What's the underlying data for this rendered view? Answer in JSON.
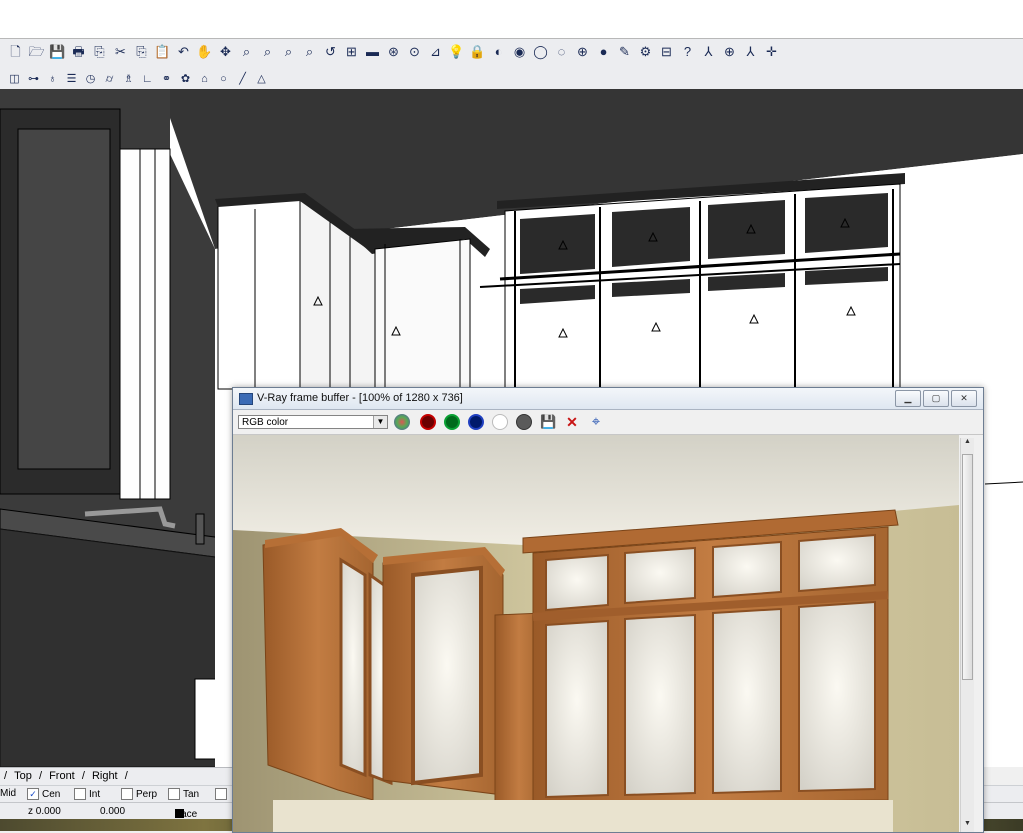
{
  "toolbar_main": {
    "icons": [
      "new-file-icon",
      "open-folder-icon",
      "save-icon",
      "print-icon",
      "import-icon",
      "cut-icon",
      "copy-icon",
      "paste-icon",
      "undo-icon",
      "pan-hand-icon",
      "rotate-view-icon",
      "zoom-icon",
      "zoom-window-icon",
      "zoom-extents-icon",
      "zoom-selected-icon",
      "undo-view-icon",
      "four-views-icon",
      "car-icon",
      "layer-icon",
      "select-icon",
      "properties-icon",
      "light-icon",
      "lock-icon",
      "shaded-icon",
      "rendered-icon",
      "ghosted-icon",
      "xray-icon",
      "render-icon",
      "material-sphere-icon",
      "paint-icon",
      "vray-gear-icon",
      "vray-options-icon",
      "help-icon",
      "axes-icon",
      "cplane-icon",
      "gumball-icon",
      "osnap-icon"
    ],
    "glyphs": [
      "🗋",
      "🗁",
      "💾",
      "🖶",
      "⎘",
      "✂",
      "⎘",
      "📋",
      "↶",
      "✋",
      "✥",
      "⌕",
      "⌕",
      "⌕",
      "⌕",
      "↺",
      "⊞",
      "▬",
      "⊛",
      "⊙",
      "⊿",
      "💡",
      "🔒",
      "◐",
      "◉",
      "◯",
      "◌",
      "⊕",
      "●",
      "✎",
      "⚙",
      "⊟",
      "?",
      "⅄",
      "⊕",
      "⅄",
      "✛"
    ]
  },
  "toolbar_secondary": {
    "icons": [
      "box-edit-icon",
      "join-icon",
      "lamp-icon",
      "list-icon",
      "clock-icon",
      "cylinder-icon",
      "person-icon",
      "angle-icon",
      "group-icon",
      "explode-icon",
      "home-icon",
      "circle-icon",
      "line-icon",
      "polygon-icon"
    ],
    "glyphs": [
      "◫",
      "⊶",
      "♁",
      "☰",
      "◷",
      "⌭",
      "♗",
      "∟",
      "⚭",
      "✿",
      "⌂",
      "○",
      "╱",
      "△"
    ]
  },
  "viewport_tabs": [
    "Top",
    "Front",
    "Right"
  ],
  "osnap": [
    {
      "label": "Mid",
      "checked": true
    },
    {
      "label": "Cen",
      "checked": true
    },
    {
      "label": "Int",
      "checked": false
    },
    {
      "label": "Perp",
      "checked": false
    },
    {
      "label": "Tan",
      "checked": false
    }
  ],
  "status": {
    "z_label": "z 0.000",
    "value": "0.000",
    "layer": "Face Fram"
  },
  "vray_window": {
    "title": "V-Ray frame buffer - [100% of 1280 x 736]",
    "channel": "RGB color",
    "tool_icons": [
      "channel-mix-icon",
      "red-channel-icon",
      "green-channel-icon",
      "blue-channel-icon",
      "alpha-channel-icon",
      "mono-icon",
      "save-image-icon",
      "clear-image-icon",
      "track-mouse-icon"
    ],
    "save_glyph": "💾",
    "clear_glyph": "✕",
    "track_glyph": "⌖"
  },
  "colors": {
    "wood": "#b8733c",
    "wood_dark": "#8a4f22",
    "wall": "#d9cda0",
    "ceiling": "#e6e2d4",
    "viewport_shadow": "#353535"
  }
}
